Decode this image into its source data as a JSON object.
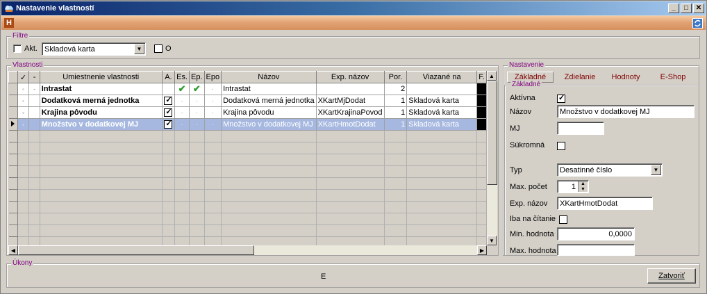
{
  "window": {
    "title": "Nastavenie vlastností",
    "min_label": "_",
    "max_label": "□",
    "close_label": "✕"
  },
  "toolbar": {
    "h_label": "H"
  },
  "filter": {
    "group_label": "Filtre",
    "akt_label": "Akt.",
    "select_value": "Skladová karta",
    "o_label": "O"
  },
  "properties": {
    "group_label": "Vlastnosti",
    "columns": [
      "✓",
      "-",
      "Umiestnenie vlastnosti",
      "A.",
      "Es.",
      "Ep.",
      "Epo",
      "Názov",
      "Exp. názov",
      "Por.",
      "Viazané na",
      "F."
    ],
    "rows": [
      {
        "dot": "◦",
        "minus": "-",
        "location": "Intrastat",
        "a": false,
        "es": true,
        "ep": true,
        "epo": "·",
        "name": "Intrastat",
        "exp": "",
        "por": "2",
        "bound": ""
      },
      {
        "dot": "◦",
        "minus": "",
        "location": "Dodatková merná jednotka",
        "a": true,
        "es": false,
        "ep": false,
        "epo": "·",
        "name": "Dodatková merná jednotka",
        "exp": "XKartMjDodat",
        "por": "1",
        "bound": "Skladová karta"
      },
      {
        "dot": "◦",
        "minus": "",
        "location": "Krajina pôvodu",
        "a": true,
        "es": false,
        "ep": false,
        "epo": "·",
        "name": "Krajina pôvodu",
        "exp": "XKartKrajinaPovod",
        "por": "1",
        "bound": "Skladová karta"
      },
      {
        "dot": "◦",
        "minus": "",
        "location": "Množstvo v dodatkovej MJ",
        "a": true,
        "es": false,
        "ep": false,
        "epo": "·",
        "name": "Množstvo v dodatkovej MJ",
        "exp": "XKartHmotDodat",
        "por": "1",
        "bound": "Skladová karta"
      }
    ],
    "selected_row": 3
  },
  "settings": {
    "group_label": "Nastavenie",
    "tabs": [
      "Základné",
      "Zdielanie",
      "Hodnoty",
      "E-Shop"
    ],
    "active_tab": 0,
    "sub_label": "Základné",
    "fields": {
      "aktivna_label": "Aktívna",
      "aktivna": true,
      "nazov_label": "Názov",
      "nazov": "Množstvo v dodatkovej MJ",
      "mj_label": "MJ",
      "mj": "",
      "sukromna_label": "Súkromná",
      "sukromna": false,
      "typ_label": "Typ",
      "typ": "Desatinné číslo",
      "max_pocet_label": "Max. počet",
      "max_pocet": "1",
      "exp_nazov_label": "Exp. názov",
      "exp_nazov": "XKartHmotDodat",
      "iba_label": "Iba na čítanie",
      "iba": false,
      "min_label": "Min. hodnota",
      "min": "0,0000",
      "max_label": "Max. hodnota",
      "max": ""
    }
  },
  "actions": {
    "group_label": "Úkony",
    "center_label": "E",
    "close_button": "Zatvoriť"
  }
}
